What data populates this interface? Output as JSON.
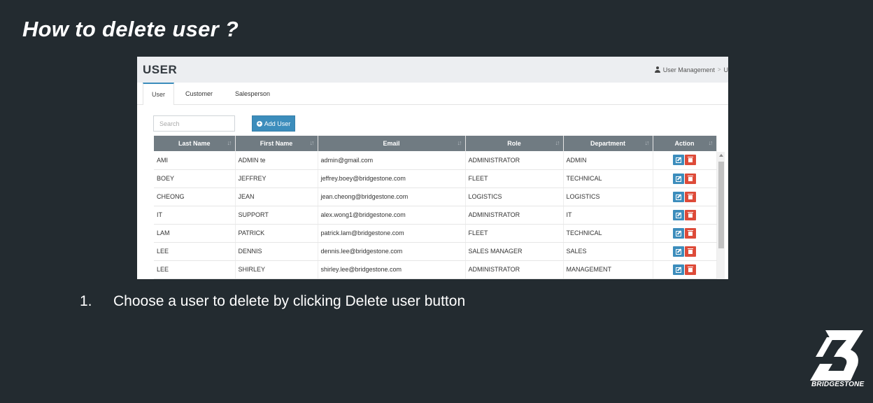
{
  "slide": {
    "title": "How to delete user ?",
    "instruction_number": "1.",
    "instruction_text": "Choose a user to delete by clicking Delete user button",
    "brand_word": "BRIDGESTONE"
  },
  "app": {
    "page_title": "USER",
    "breadcrumb": [
      "User Management",
      "U"
    ],
    "tabs": [
      {
        "label": "User",
        "active": true
      },
      {
        "label": "Customer",
        "active": false
      },
      {
        "label": "Salesperson",
        "active": false
      }
    ],
    "search": {
      "placeholder": "Search",
      "value": ""
    },
    "add_button": {
      "label": "Add User",
      "icon": "plus-circle-icon"
    },
    "table": {
      "columns": [
        "Last Name",
        "First Name",
        "Email",
        "Role",
        "Department",
        "Action"
      ],
      "rows": [
        [
          "AMI",
          "ADMIN te",
          "admin@gmail.com",
          "ADMINISTRATOR",
          "ADMIN"
        ],
        [
          "BOEY",
          "JEFFREY",
          "jeffrey.boey@bridgestone.com",
          "FLEET",
          "TECHNICAL"
        ],
        [
          "CHEONG",
          "JEAN",
          "jean.cheong@bridgestone.com",
          "LOGISTICS",
          "LOGISTICS"
        ],
        [
          "IT",
          "SUPPORT",
          "alex.wong1@bridgestone.com",
          "ADMINISTRATOR",
          "IT"
        ],
        [
          "LAM",
          "PATRICK",
          "patrick.lam@bridgestone.com",
          "FLEET",
          "TECHNICAL"
        ],
        [
          "LEE",
          "DENNIS",
          "dennis.lee@bridgestone.com",
          "SALES MANAGER",
          "SALES"
        ],
        [
          "LEE",
          "SHIRLEY",
          "shirley.lee@bridgestone.com",
          "ADMINISTRATOR",
          "MANAGEMENT"
        ]
      ],
      "row_actions": [
        "edit-icon",
        "trash-icon"
      ]
    }
  },
  "colors": {
    "background": "#232b30",
    "primary": "#3c8dbc",
    "danger": "#dd4b39",
    "table_header": "#707b82"
  }
}
